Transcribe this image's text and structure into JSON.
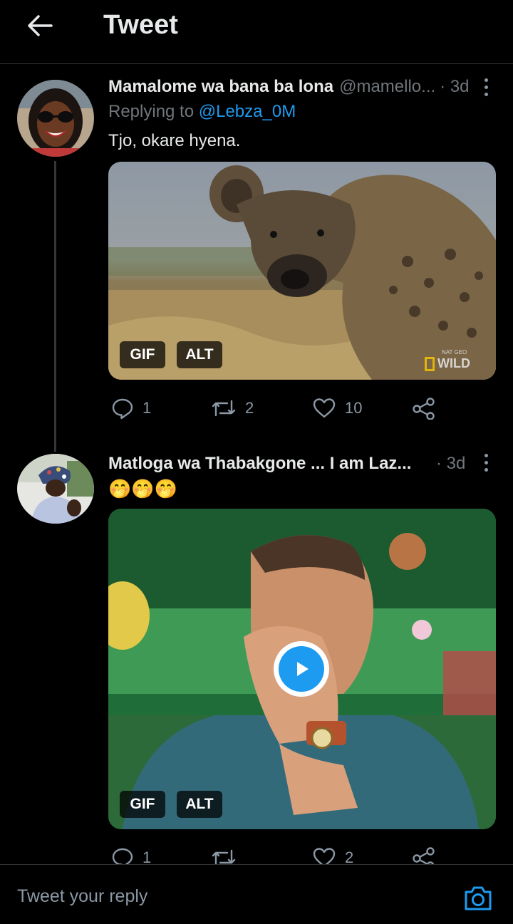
{
  "header": {
    "title": "Tweet",
    "back_icon": "arrow-left-icon"
  },
  "tweets": [
    {
      "name": "Mamalome wa bana ba lona",
      "handle": "@mamello...",
      "time": "· 3d",
      "replying_prefix": "Replying to ",
      "replying_to": "@Lebza_0M",
      "text": "Tjo, okare hyena.",
      "media": {
        "type": "gif",
        "gif_label": "GIF",
        "alt_label": "ALT",
        "watermark": "WILD",
        "watermark_small": "NAT GEO"
      },
      "stats": {
        "replies": "1",
        "retweets": "2",
        "likes": "10"
      }
    },
    {
      "name": "Matloga wa Thabakgone ... I am Laz...",
      "time": "· 3d",
      "text": "🤭🤭🤭",
      "media": {
        "type": "gif",
        "gif_label": "GIF",
        "alt_label": "ALT"
      },
      "stats": {
        "replies": "1",
        "retweets": "",
        "likes": "2"
      }
    }
  ],
  "composer": {
    "placeholder": "Tweet your reply",
    "camera_icon": "camera-icon"
  },
  "colors": {
    "background": "#000000",
    "accent": "#1d9bf0",
    "muted": "#71767b",
    "text": "#e7e9ea"
  }
}
